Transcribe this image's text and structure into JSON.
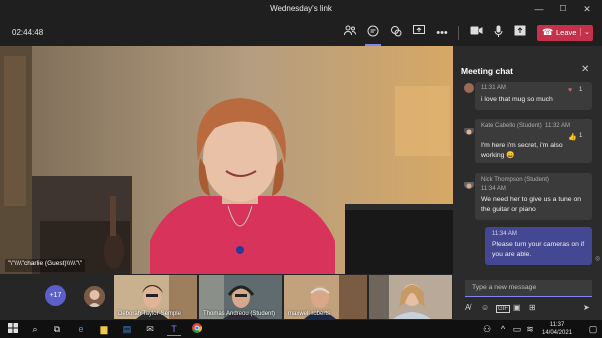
{
  "window": {
    "title": "Wednesday's link",
    "minimize": "—",
    "maximize": "☐",
    "close": "✕"
  },
  "toolbar": {
    "timer": "02:44:48",
    "leave_label": "Leave",
    "leave_icon": "phone-hangup-icon",
    "icons": [
      "people-icon",
      "chat-icon",
      "reactions-icon",
      "share-tray-icon",
      "more-icon",
      "camera-icon",
      "mic-icon",
      "share-icon"
    ]
  },
  "video": {
    "presenter_name": "\"\\\"\\\\\\\\\"charlie (Guest)\\\\\\\\\\\"\\\""
  },
  "participants": {
    "overflow": "+17",
    "tiles": [
      {
        "name": "Deborah Taylor-Semple"
      },
      {
        "name": "Thomas Andreou (Student)"
      },
      {
        "name": "maxwell roberts"
      },
      {
        "name": ""
      }
    ]
  },
  "chat": {
    "title": "Meeting chat",
    "messages": [
      {
        "sender": "",
        "time": "11:31 AM",
        "text": "i love that mug so much",
        "reaction_count": "1"
      },
      {
        "sender": "Kate Cabello (Student)",
        "time": "11:32 AM",
        "text": "I'm here i'm secret, i'm also working 😄",
        "reaction_count": "1"
      },
      {
        "sender": "Nick Thompson (Student)",
        "time": "11:34 AM",
        "text": "We need her to give us a tune on the guitar or piano"
      },
      {
        "sender": "",
        "time": "11:34 AM",
        "text": "Please turn your cameras on if you are able.",
        "self": true
      }
    ],
    "compose_placeholder": "Type a new message"
  },
  "taskbar": {
    "time": "11:37",
    "date": "14/04/2021"
  },
  "colors": {
    "accent": "#5b5fc7",
    "leave": "#c4314b",
    "background": "#1f1f1f"
  }
}
